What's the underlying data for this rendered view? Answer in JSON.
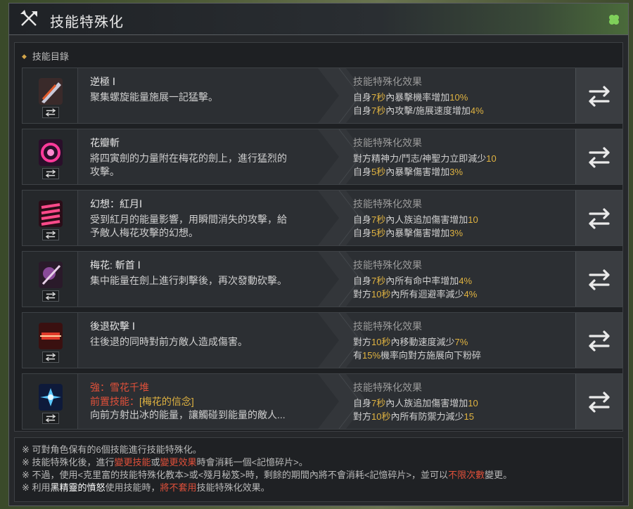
{
  "window": {
    "title": "技能特殊化",
    "title_icon": "crossed-axes-icon",
    "corner_icon": "clover-icon"
  },
  "section": {
    "label": "技能目錄"
  },
  "colors": {
    "highlight": "#e0b341",
    "warning": "#e0503a",
    "bg": "#26282b"
  },
  "skills": [
    {
      "name": "逆極 Ⅰ",
      "desc": [
        "聚集螺旋能量施展一記猛擊。"
      ],
      "effect_title": "技能特殊化效果",
      "effects": [
        {
          "p1": "自身",
          "h1": "7秒",
          "p2": "內暴擊機率增加",
          "h2": "10%"
        },
        {
          "p1": "自身",
          "h1": "7秒",
          "p2": "內攻擊/施展速度增加",
          "h2": "4%"
        }
      ]
    },
    {
      "name": "花瓣斬",
      "desc": [
        "將四寅劍的力量附在梅花的劍上，進行猛烈的",
        "攻擊。"
      ],
      "effect_title": "技能特殊化效果",
      "effects": [
        {
          "p1": "對方精神力/鬥志/神聖力立即減少",
          "h1": "10",
          "p2": "",
          "h2": ""
        },
        {
          "p1": "自身",
          "h1": "5秒",
          "p2": "內暴擊傷害增加",
          "h2": "3%"
        }
      ]
    },
    {
      "name": "幻想：紅月Ⅰ",
      "desc": [
        "受到紅月的能量影響，用瞬間消失的攻擊，給",
        "予敵人梅花攻擊的幻想。"
      ],
      "effect_title": "技能特殊化效果",
      "effects": [
        {
          "p1": "自身",
          "h1": "7秒",
          "p2": "內人族追加傷害增加",
          "h2": "10"
        },
        {
          "p1": "自身",
          "h1": "5秒",
          "p2": "內暴擊傷害增加",
          "h2": "3%"
        }
      ]
    },
    {
      "name": "梅花: 斬首 Ⅰ",
      "desc": [
        "集中能量在劍上進行刺擊後，再次發動砍擊。"
      ],
      "effect_title": "技能特殊化效果",
      "effects": [
        {
          "p1": "自身",
          "h1": "7秒",
          "p2": "內所有命中率增加",
          "h2": "4%"
        },
        {
          "p1": "對方",
          "h1": "10秒",
          "p2": "內所有迴避率減少",
          "h2": "4%"
        }
      ]
    },
    {
      "name": "後退砍擊 Ⅰ",
      "desc": [
        "往後退的同時對前方敵人造成傷害。"
      ],
      "effect_title": "技能特殊化效果",
      "effects": [
        {
          "p1": "對方",
          "h1": "10秒",
          "p2": "內移動速度減少",
          "h2": "7%"
        },
        {
          "p1": "有",
          "h1": "15%",
          "p2": "機率向對方施展向下粉碎",
          "h2": ""
        }
      ]
    },
    {
      "name": "強：雪花千堆",
      "prereq_label": "前置技能：",
      "prereq_value": "[梅花的信念]",
      "desc": [
        "向前方射出冰的能量，讓觸碰到能量的敵人..."
      ],
      "effect_title": "技能特殊化效果",
      "effects": [
        {
          "p1": "自身",
          "h1": "7秒",
          "p2": "內人族追加傷害增加",
          "h2": "10"
        },
        {
          "p1": "對方",
          "h1": "10秒",
          "p2": "內所有防禦力減少",
          "h2": "15"
        }
      ]
    }
  ],
  "notes": [
    {
      "parts": [
        {
          "t": "※ 可對角色保有的6個技能進行技能特殊化。",
          "c": ""
        }
      ]
    },
    {
      "parts": [
        {
          "t": "※ 技能特殊化後，進行",
          "c": ""
        },
        {
          "t": "變更技能",
          "c": "red"
        },
        {
          "t": "或",
          "c": ""
        },
        {
          "t": "變更效果",
          "c": "red"
        },
        {
          "t": "時會消耗一個<記憶碎片>。",
          "c": ""
        }
      ]
    },
    {
      "parts": [
        {
          "t": "※ 不過，使用<克里富的技能特殊化教本>或<殘月秘笈>時，剩餘的期間內將不會消耗<記憶碎片>，並可以",
          "c": ""
        },
        {
          "t": "不限次數",
          "c": "red"
        },
        {
          "t": "變更。",
          "c": ""
        }
      ]
    },
    {
      "parts": [
        {
          "t": "※ 利用",
          "c": ""
        },
        {
          "t": "黑精靈的憤怒",
          "c": "white"
        },
        {
          "t": "使用技能時，",
          "c": ""
        },
        {
          "t": "將不套用",
          "c": "red"
        },
        {
          "t": "技能特殊化效果。",
          "c": ""
        }
      ]
    }
  ]
}
